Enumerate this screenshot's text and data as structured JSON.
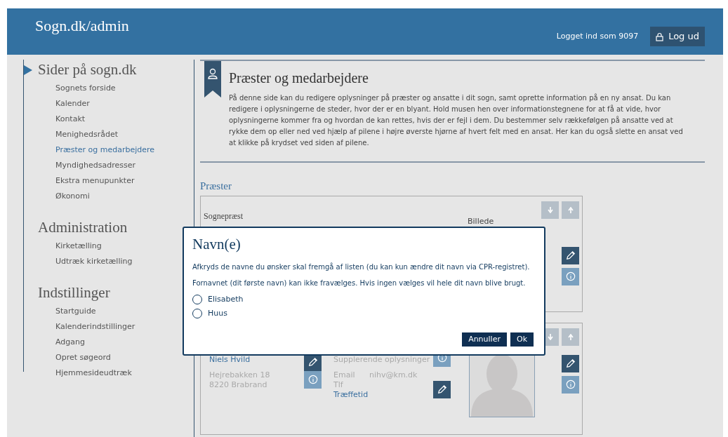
{
  "header": {
    "title": "Sogn.dk/admin",
    "user": "Logget ind som 9097",
    "logout": "Log ud"
  },
  "sidebar": {
    "sections": [
      {
        "title": "Sider på sogn.dk",
        "selected": true,
        "items": [
          {
            "label": "Sognets forside",
            "selected": false
          },
          {
            "label": "Kalender",
            "selected": false
          },
          {
            "label": "Kontakt",
            "selected": false
          },
          {
            "label": "Menighedsrådet",
            "selected": false
          },
          {
            "label": "Præster og medarbejdere",
            "selected": true
          },
          {
            "label": "Myndighedsadresser",
            "selected": false
          },
          {
            "label": "Ekstra menupunkter",
            "selected": false
          },
          {
            "label": "Økonomi",
            "selected": false
          }
        ]
      },
      {
        "title": "Administration",
        "selected": false,
        "items": [
          {
            "label": "Kirketælling",
            "selected": false
          },
          {
            "label": "Udtræk kirketælling",
            "selected": false
          }
        ]
      },
      {
        "title": "Indstillinger",
        "selected": false,
        "items": [
          {
            "label": "Startguide",
            "selected": false
          },
          {
            "label": "Kalenderindstillinger",
            "selected": false
          },
          {
            "label": "Adgang",
            "selected": false
          },
          {
            "label": "Opret søgeord",
            "selected": false
          },
          {
            "label": "Hjemmesideudtræk",
            "selected": false
          }
        ]
      }
    ]
  },
  "page": {
    "title": "Præster og medarbejdere",
    "description": "På denne side kan du redigere oplysninger på præster og ansatte i dit sogn, samt oprette information på en ny ansat. Du kan redigere i oplysningerne de steder, hvor der er en blyant. Hold musen hen over informationstegnene for at få at vide, hvor oplysningerne kommer fra og hvordan de kan rettes, hvis der er fejl i dem. Du bestemmer selv rækkefølgen på ansatte ved at rykke dem op eller ned ved hjælp af pilene i højre øverste hjørne af hvert felt med en ansat. Her kan du også slette en ansat ved at klikke på krydset ved siden af pilene."
  },
  "section_title": "Præster",
  "cards": [
    {
      "role": "Sognepræst",
      "photo_label": "Billede"
    },
    {
      "name": "Niels Hvild",
      "address": [
        "Hejrebakken 18",
        "8220 Brabrand"
      ],
      "extra": "Supplerende oplysninger",
      "contacts": [
        {
          "label": "Email",
          "value": "nihv@km.dk"
        },
        {
          "label": "Tlf"
        }
      ],
      "office_hours": "Træffetid"
    }
  ],
  "dialog": {
    "title": "Navn(e)",
    "lines": [
      "Afkryds de navne du ønsker skal fremgå af listen (du kan kun ændre dit navn via CPR-registret).",
      "Fornavnet (dit første navn) kan ikke fravælges. Hvis ingen vælges vil hele dit navn blive brugt."
    ],
    "options": [
      {
        "label": "Elisabeth",
        "selected": false
      },
      {
        "label": "Huus",
        "selected": false
      }
    ],
    "buttons": [
      "Annuller",
      "Ok"
    ]
  }
}
